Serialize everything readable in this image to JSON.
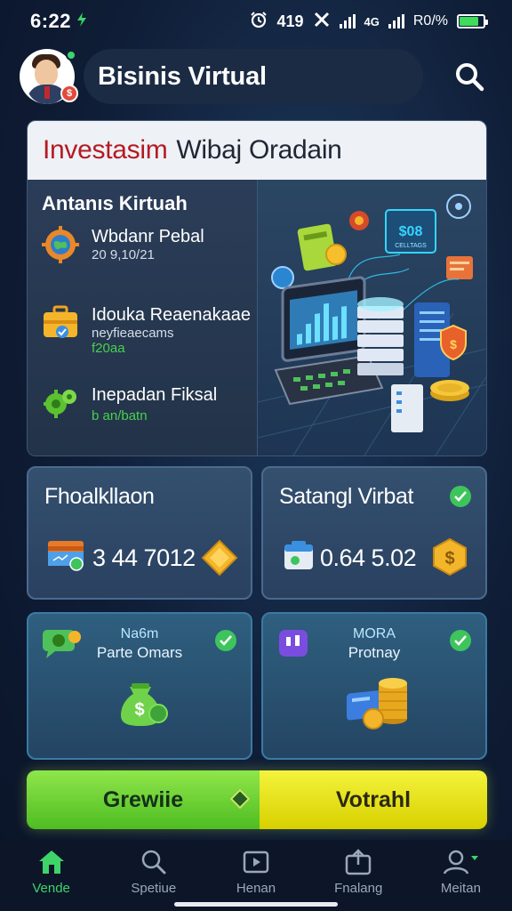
{
  "status": {
    "time": "6:22",
    "right_text": "419",
    "net1": "4G",
    "net2": "R0/%"
  },
  "header": {
    "title": "Bisinis Virtual",
    "badge": "$"
  },
  "panel": {
    "title_red": "Investasim",
    "title_dark": "Wibaj Oradain",
    "subtitle": "Antanıs Kirtuah",
    "items": [
      {
        "title": "Wbdanr Pebal",
        "detail": "20 9,10/21"
      },
      {
        "title": "Idouka Reaenakaae",
        "detail": "neyfieaecams",
        "detail2": "f20aa"
      },
      {
        "title": "Inepadan Fiksal",
        "detail": "b an/batn"
      }
    ],
    "screen_text": "$08",
    "screen_text2": "CELLTAGS",
    "coin_symbol": "$"
  },
  "cards": {
    "a": {
      "title": "Fhoalkllaon",
      "amount": "3 44 7012"
    },
    "b": {
      "title": "Satangl Virbat",
      "amount": "0.64 5.02",
      "coin": "$"
    },
    "c": {
      "heading": "Na6m",
      "sub": "Parte Omars",
      "bag_symbol": "$"
    },
    "d": {
      "heading": "MORA",
      "sub": "Protnay"
    }
  },
  "buttons": {
    "left": "Grewiie",
    "right": "Votrahl"
  },
  "nav": [
    {
      "label": "Vende",
      "icon": "home-icon",
      "active": true
    },
    {
      "label": "Spetiue",
      "icon": "search-icon",
      "active": false
    },
    {
      "label": "Henan",
      "icon": "video-icon",
      "active": false
    },
    {
      "label": "Fnalang",
      "icon": "upload-icon",
      "active": false
    },
    {
      "label": "Meitan",
      "icon": "profile-icon",
      "active": false
    }
  ],
  "colors": {
    "accent_green": "#3ed46a",
    "button_green": "#6fd43a",
    "button_yellow": "#eae51c",
    "title_red": "#b31b22"
  }
}
